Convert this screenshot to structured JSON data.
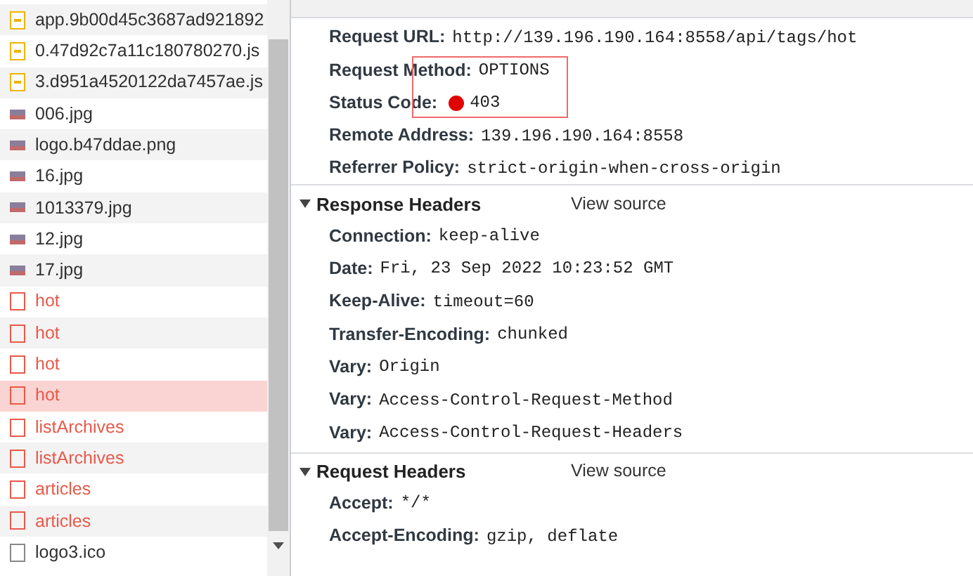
{
  "requests": [
    {
      "name": "app.9b00d45c3687ad921892",
      "kind": "script",
      "selected": false
    },
    {
      "name": "0.47d92c7a11c180780270.js",
      "kind": "script",
      "selected": false
    },
    {
      "name": "3.d951a4520122da7457ae.js",
      "kind": "script",
      "selected": false
    },
    {
      "name": "006.jpg",
      "kind": "image",
      "selected": false
    },
    {
      "name": "logo.b47ddae.png",
      "kind": "image",
      "selected": false
    },
    {
      "name": "16.jpg",
      "kind": "image",
      "selected": false
    },
    {
      "name": "1013379.jpg",
      "kind": "image",
      "selected": false
    },
    {
      "name": "12.jpg",
      "kind": "image",
      "selected": false
    },
    {
      "name": "17.jpg",
      "kind": "image",
      "selected": false
    },
    {
      "name": "hot",
      "kind": "error",
      "selected": false
    },
    {
      "name": "hot",
      "kind": "error",
      "selected": false
    },
    {
      "name": "hot",
      "kind": "error",
      "selected": false
    },
    {
      "name": "hot",
      "kind": "error",
      "selected": true
    },
    {
      "name": "listArchives",
      "kind": "error",
      "selected": false
    },
    {
      "name": "listArchives",
      "kind": "error",
      "selected": false
    },
    {
      "name": "articles",
      "kind": "error",
      "selected": false
    },
    {
      "name": "articles",
      "kind": "error",
      "selected": false
    },
    {
      "name": "logo3.ico",
      "kind": "other",
      "selected": false
    }
  ],
  "general": [
    {
      "label": "Request URL:",
      "value": "http://139.196.190.164:8558/api/tags/hot"
    },
    {
      "label": "Request Method:",
      "value": "OPTIONS"
    },
    {
      "label": "Status Code:",
      "value": "403",
      "status_dot": true
    },
    {
      "label": "Remote Address:",
      "value": "139.196.190.164:8558"
    },
    {
      "label": "Referrer Policy:",
      "value": "strict-origin-when-cross-origin"
    }
  ],
  "sections": [
    {
      "title": "Response Headers",
      "link": "View source",
      "expanded": true,
      "headers": [
        {
          "label": "Connection:",
          "value": "keep-alive"
        },
        {
          "label": "Date:",
          "value": "Fri, 23 Sep 2022 10:23:52 GMT"
        },
        {
          "label": "Keep-Alive:",
          "value": "timeout=60"
        },
        {
          "label": "Transfer-Encoding:",
          "value": "chunked"
        },
        {
          "label": "Vary:",
          "value": "Origin"
        },
        {
          "label": "Vary:",
          "value": "Access-Control-Request-Method"
        },
        {
          "label": "Vary:",
          "value": "Access-Control-Request-Headers"
        }
      ]
    },
    {
      "title": "Request Headers",
      "link": "View source",
      "expanded": true,
      "headers": [
        {
          "label": "Accept:",
          "value": "*/*"
        },
        {
          "label": "Accept-Encoding:",
          "value": "gzip, deflate"
        }
      ]
    }
  ]
}
